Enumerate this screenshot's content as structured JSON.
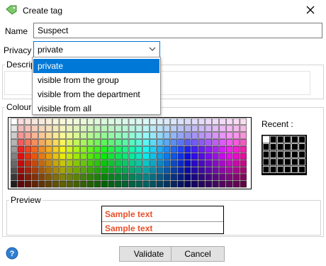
{
  "window": {
    "title": "Create tag",
    "icon": "tag-icon",
    "close_icon": "close-icon"
  },
  "form": {
    "name_label": "Name",
    "name_value": "Suspect",
    "privacy_label": "Privacy",
    "privacy_value": "private",
    "privacy_options": [
      "private",
      "visible from the group",
      "visible from the department",
      "visible from all"
    ],
    "description_label": "Descrip",
    "colour_label": "Colour",
    "recent_label": "Recent :",
    "preview_label": "Preview",
    "sample_text": "Sample text",
    "sample_color": "#e8502b"
  },
  "buttons": {
    "validate": "Validate",
    "cancel": "Cancel",
    "help_icon": "help-icon"
  },
  "colors": {
    "accent": "#0078d7",
    "recent_swatch": "#000000"
  }
}
